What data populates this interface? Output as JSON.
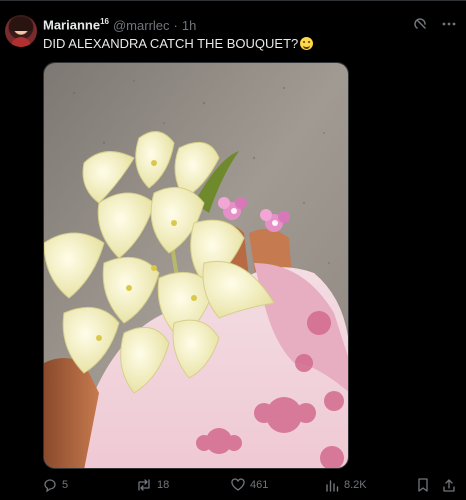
{
  "tweet": {
    "display_name": "Marianne",
    "name_superscript": "16",
    "handle": "@marrlec",
    "separator": "·",
    "time": "1h",
    "text": "DID ALEXANDRA CATCH THE BOUQUET?",
    "emoji": "grinning-face-with-big-eyes",
    "stats": {
      "replies": "5",
      "reposts": "18",
      "likes": "461",
      "views": "8.2K"
    }
  },
  "colors": {
    "background": "#000000",
    "text_primary": "#e7e9ea",
    "text_secondary": "#71767b",
    "divider": "#2f3336"
  },
  "icons": {
    "top": [
      "grok-icon",
      "more-icon"
    ],
    "actions": [
      "reply-icon",
      "repost-icon",
      "like-icon",
      "views-icon",
      "bookmark-icon",
      "share-icon"
    ]
  }
}
